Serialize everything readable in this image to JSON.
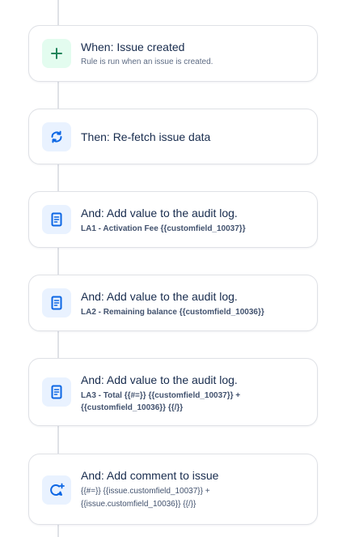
{
  "steps": [
    {
      "kind": "trigger",
      "icon": "plus-icon",
      "title": "When: Issue created",
      "description": "Rule is run when an issue is created."
    },
    {
      "kind": "action",
      "icon": "refresh-icon",
      "title": "Then: Re-fetch issue data"
    },
    {
      "kind": "action",
      "icon": "document-icon",
      "title": "And: Add value to the audit log.",
      "description": "LA1 - Activation Fee {{customfield_10037}}"
    },
    {
      "kind": "action",
      "icon": "document-icon",
      "title": "And: Add value to the audit log.",
      "description": "LA2 - Remaining balance {{customfield_10036}}"
    },
    {
      "kind": "action",
      "icon": "document-icon",
      "title": "And: Add value to the audit log.",
      "description_lines": [
        "LA3 - Total {{#=}} {{customfield_10037}} +",
        "{{customfield_10036}} {{/}}"
      ]
    },
    {
      "kind": "action",
      "icon": "comment-add-icon",
      "title": "And: Add comment to issue",
      "description_lines": [
        "{{#=}} {{issue.customfield_10037}} +",
        "{{issue.customfield_10036}} {{/}}"
      ]
    }
  ],
  "colors": {
    "trigger_icon": "#1f845a",
    "action_icon": "#0c66e4",
    "border": "#dfe1e6",
    "text": "#172b4d"
  }
}
